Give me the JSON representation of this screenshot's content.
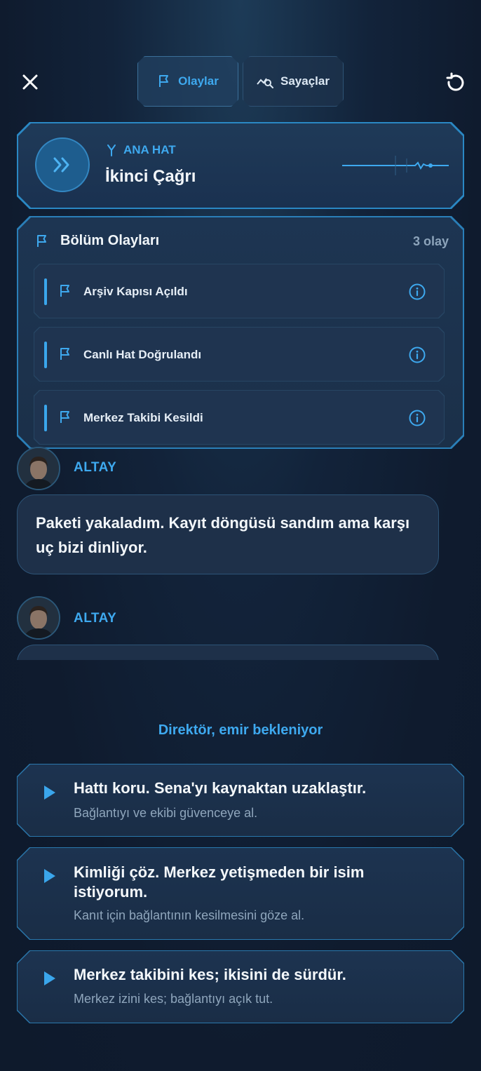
{
  "header": {
    "close_icon": "close-icon",
    "refresh_icon": "refresh-icon",
    "tabs": [
      {
        "label": "Olaylar",
        "icon": "flag-icon",
        "active": true
      },
      {
        "label": "Sayaçlar",
        "icon": "chart-search-icon",
        "active": false
      }
    ]
  },
  "line_card": {
    "kicker": "ANA HAT",
    "title": "İkinci Çağrı",
    "play_icon": "double-chevron-right-icon"
  },
  "events": {
    "title": "Bölüm Olayları",
    "count": "3 olay",
    "items": [
      {
        "label": "Arşiv Kapısı Açıldı"
      },
      {
        "label": "Canlı Hat Doğrulandı"
      },
      {
        "label": "Merkez Takibi Kesildi"
      }
    ]
  },
  "messages": [
    {
      "speaker": "ALTAY",
      "text": "Paketi yakaladım. Kayıt döngüsü sandım ama karşı uç bizi dinliyor."
    },
    {
      "speaker": "ALTAY",
      "text": ""
    }
  ],
  "waiting_text": "Direktör, emir bekleniyor",
  "choices": [
    {
      "title": "Hattı koru. Sena'yı kaynaktan uzaklaştır.",
      "subtitle": "Bağlantıyı ve ekibi güvenceye al."
    },
    {
      "title": "Kimliği çöz. Merkez yetişmeden bir isim istiyorum.",
      "subtitle": "Kanıt için bağlantının kesilmesini göze al."
    },
    {
      "title": "Merkez takibini kes; ikisini de sürdür.",
      "subtitle": "Merkez izini kes; bağlantıyı açık tut."
    }
  ],
  "colors": {
    "accent": "#3ea9ef",
    "background": "#0f1b2e",
    "card": "#1e3049"
  }
}
